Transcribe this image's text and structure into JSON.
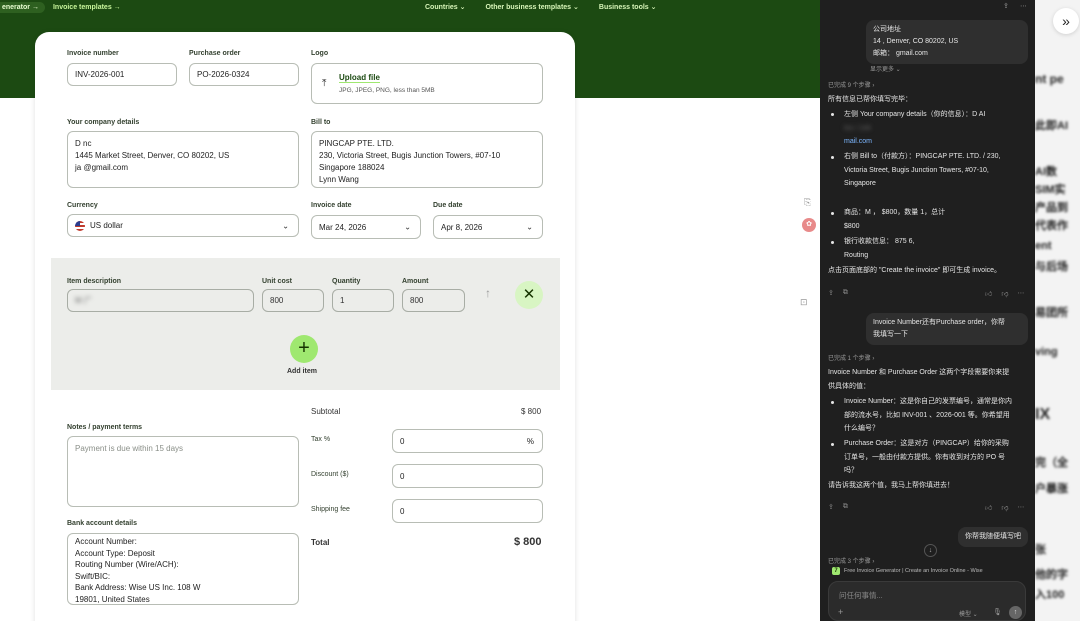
{
  "nav": {
    "pill": "enerator →",
    "templates": "Invoice templates →",
    "countries": "Countries ⌄",
    "other_templates": "Other business templates ⌄",
    "business_tools": "Business tools ⌄"
  },
  "form": {
    "invoice_number_label": "Invoice number",
    "invoice_number": "INV-2026-001",
    "purchase_order_label": "Purchase order",
    "purchase_order": "PO-2026-0324",
    "logo_label": "Logo",
    "upload_link": "Upload file",
    "upload_hint": "JPG, JPEG, PNG, less than 5MB",
    "company_label": "Your company details",
    "company_lines": [
      "D              nc",
      "1445 Market Street, Denver, CO 80202, US",
      "ja             @gmail.com"
    ],
    "bill_to_label": "Bill to",
    "bill_to_lines": [
      "PINGCAP PTE. LTD.",
      "230, Victoria Street, Bugis Junction Towers, #07-10",
      "Singapore 188024",
      "Lynn Wang"
    ],
    "currency_label": "Currency",
    "currency": "US dollar",
    "invoice_date_label": "Invoice date",
    "invoice_date": "Mar 24, 2026",
    "due_date_label": "Due date",
    "due_date": "Apr 8, 2026",
    "item_desc_label": "Item description",
    "item_desc": "M       广",
    "unit_cost_label": "Unit cost",
    "unit_cost": "800",
    "quantity_label": "Quantity",
    "quantity": "1",
    "amount_label": "Amount",
    "amount": "800",
    "add_item": "Add item",
    "notes_label": "Notes / payment terms",
    "notes_placeholder": "Payment is due within 15 days",
    "subtotal_label": "Subtotal",
    "subtotal": "$ 800",
    "tax_label": "Tax %",
    "tax": "0",
    "tax_unit": "%",
    "discount_label": "Discount ($)",
    "discount": "0",
    "shipping_label": "Shipping fee",
    "shipping": "0",
    "bank_label": "Bank account details",
    "bank_lines": [
      "Account Number:",
      "Account Type: Deposit",
      "Routing Number (Wire/ACH):",
      "Swift/BIC:",
      "Bank Address: Wise US Inc. 108 W",
      "19801, United States"
    ],
    "total_label": "Total",
    "total": "$ 800"
  },
  "chat": {
    "top_bubble": [
      "公司地址",
      "14              , Denver, CO 80202, US",
      "邮箱：           gmail.com"
    ],
    "show_more": "显示更多 ⌄",
    "steps_9": "已完成 9 个步骤 ›",
    "intro": "所有信息已帮你填写完毕：",
    "bullets": [
      [
        "左侧 Your company details（你的信息）：D        AI",
        "Inc / 144                              ",
        "                          mail.com"
      ],
      [
        "右侧 Bill to（付款方）：PINGCAP PTE. LTD. / 230,",
        "Victoria Street, Bugis Junction Towers, #07-10,",
        "Singapore                ",
        "                    "
      ],
      [
        "商品：M             ，     $800，数量 1，总计",
        "$800"
      ],
      [
        "银行收款信息：            875              6,",
        "Routing              "
      ]
    ],
    "closing": "点击页面底部的 \"Create the invoice\" 即可生成 invoice。",
    "user_msg1": [
      "Invoice Number还有Purchase order，你帮",
      "我填写一下"
    ],
    "steps_1": "已完成 1 个步骤 ›",
    "reply_intro": [
      "Invoice Number 和 Purchase Order 这两个字段需要你来提",
      "供具体的值："
    ],
    "reply_b1": [
      "Invoice Number：这是你自己的发票编号，通常是你内",
      "部的流水号，比如 INV-001 、2026-001 等。你希望用",
      "什么编号？"
    ],
    "reply_b2": [
      "Purchase Order：这是对方（PINGCAP）给你的采购",
      "订单号，一般由付款方提供。你有收到对方的 PO 号",
      "吗？"
    ],
    "reply_close": "请告诉我这两个值，我马上帮你填进去！",
    "user_msg2": "你帮我随便填写吧",
    "steps_3": "已完成 3 个步骤 ›",
    "source": "Free Invoice Generator | Create an Invoice Online - Wise",
    "input_placeholder": "问任何事情...",
    "model_label": "模型 ⌄"
  },
  "strip_fragments": [
    "nt pe",
    "此即AI",
    "AI数",
    "SIM实",
    "产品到",
    "代表作",
    "ent",
    "与后场",
    "易团所",
    "ving",
    "IX",
    "完（全",
    "户暴涨",
    "张",
    "他的字",
    "入100"
  ]
}
